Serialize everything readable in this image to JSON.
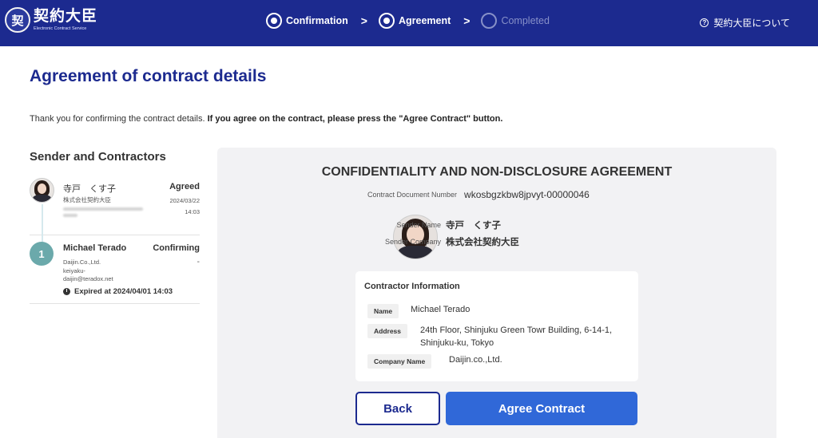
{
  "header": {
    "logo_name": "契約大臣",
    "logo_sub": "Electronic Contract Service",
    "logo_seal": "契",
    "steps": [
      {
        "label": "Confirmation",
        "state": "done"
      },
      {
        "label": "Agreement",
        "state": "active"
      },
      {
        "label": "Completed",
        "state": "pending"
      }
    ],
    "step_separator": ">",
    "about_label": "契約大臣について",
    "about_icon": "?"
  },
  "page": {
    "title": "Agreement of contract details",
    "intro_plain": "Thank you for confirming the contract details. ",
    "intro_bold": "If you agree on the contract, please press the \"Agree Contract\" button."
  },
  "sidebar": {
    "heading": "Sender and Contractors",
    "sender": {
      "name": "寺戸　くす子",
      "company": "株式会社契約大臣",
      "status": "Agreed",
      "date": "2024/03/22",
      "time": "14:03"
    },
    "contractor": {
      "number": "1",
      "name": "Michael Terado",
      "status": "Confirming",
      "status_detail": "-",
      "company": "Daijin.Co.,Ltd.",
      "email_line1": "keiyaku-",
      "email_line2": "daijin@teradox.net",
      "expired": "Expired at 2024/04/01 14:03"
    }
  },
  "document": {
    "title": "CONFIDENTIALITY AND NON-DISCLOSURE AGREEMENT",
    "number_label": "Contract Document Number",
    "number_value": "wkosbgzkbw8jpvyt-00000046",
    "sender_name_label": "Sender Name",
    "sender_name": "寺戸　くす子",
    "sender_company_label": "Sender Company",
    "sender_company": "株式会社契約大臣",
    "contractor_heading": "Contractor Information",
    "name_label": "Name",
    "name_value": "Michael Terado",
    "address_label": "Address",
    "address_line1": "24th Floor, Shinjuku Green Towr Building, 6-14-1,",
    "address_line2": "Shinjuku-ku, Tokyo",
    "company_label": "Company Name",
    "company_value": "Daijin.co.,Ltd."
  },
  "buttons": {
    "back": "Back",
    "agree": "Agree Contract"
  },
  "colors": {
    "header_bg": "#1c2a8f",
    "title": "#1c2a8f",
    "agree_button": "#3068d8",
    "badge": "#6ba9ab"
  }
}
